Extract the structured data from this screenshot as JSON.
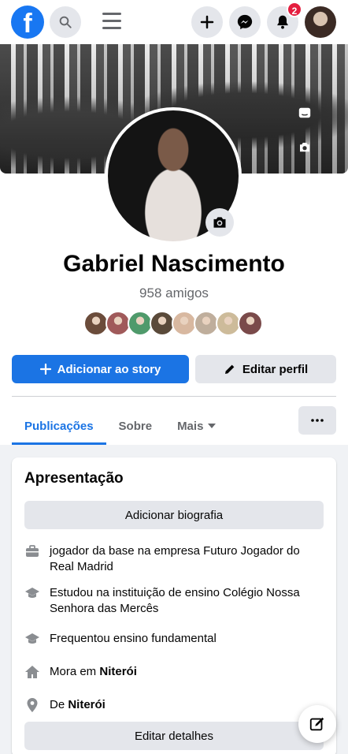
{
  "nav": {
    "logo_letter": "f",
    "notifications_badge": "2"
  },
  "profile": {
    "name": "Gabriel Nascimento",
    "friends_count": "958 amigos",
    "friend_avatar_colors": [
      "#6b4c3b",
      "#a05a5a",
      "#4f9a6b",
      "#5a4a3a",
      "#d8b8a0",
      "#bfae9c",
      "#cdbb9a",
      "#7a4a4a"
    ],
    "add_story_label": "Adicionar ao story",
    "edit_profile_label": "Editar perfil"
  },
  "tabs": [
    {
      "label": "Publicações"
    },
    {
      "label": "Sobre"
    },
    {
      "label": "Mais"
    }
  ],
  "intro": {
    "title": "Apresentação",
    "add_bio_label": "Adicionar biografia",
    "work": "jogador da base na empresa Futuro Jogador do Real Madrid",
    "education": "Estudou na instituição de ensino Colégio Nossa Senhora das Mercês",
    "school": "Frequentou ensino fundamental",
    "lives_prefix": "Mora em ",
    "lives_city": "Niterói",
    "from_prefix": "De ",
    "from_city": "Niterói",
    "edit_details_label": "Editar detalhes"
  },
  "colors": {
    "brand": "#1877f2",
    "primary_button": "#1b74e4",
    "badge": "#e41e3f"
  },
  "icons": [
    "facebook-logo",
    "search-icon",
    "menu-icon",
    "plus-icon",
    "messenger-icon",
    "bell-icon",
    "camera-icon",
    "pencil-icon",
    "briefcase-icon",
    "graduation-cap-icon",
    "home-icon",
    "location-pin-icon",
    "edit-post-icon"
  ]
}
